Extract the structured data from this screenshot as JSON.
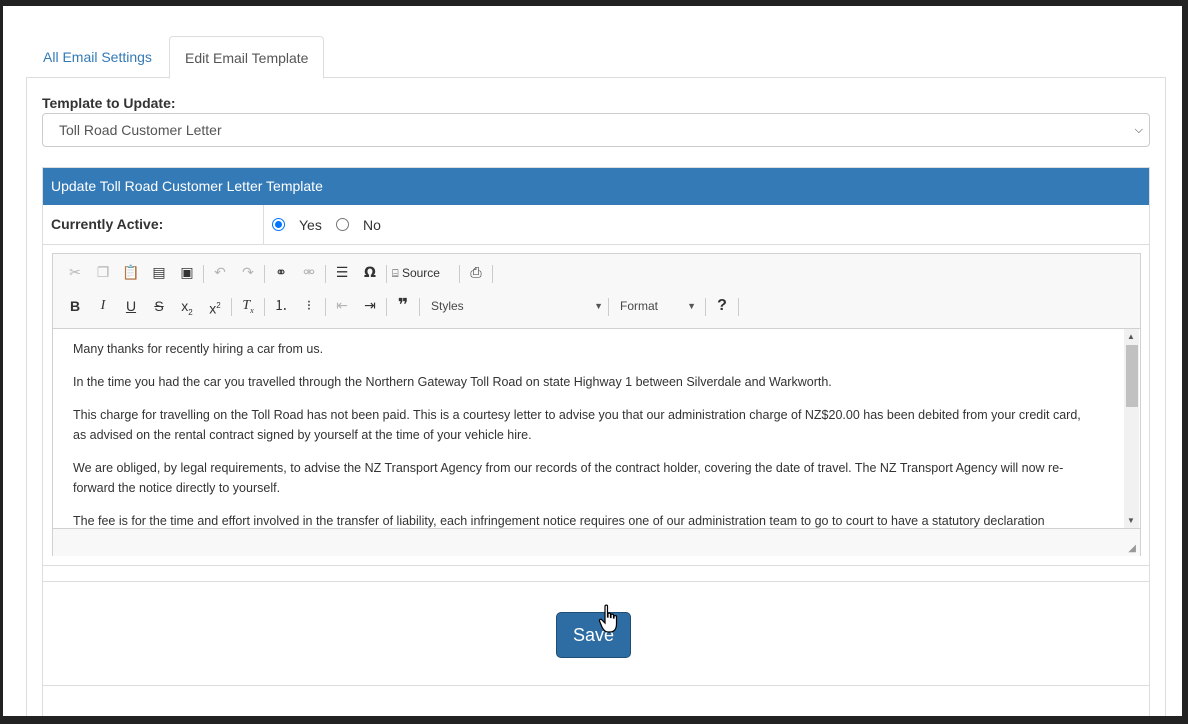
{
  "tabs": [
    {
      "label": "All Email Settings",
      "active": false
    },
    {
      "label": "Edit Email Template",
      "active": true
    }
  ],
  "template_select": {
    "label": "Template to Update:",
    "value": "Toll Road Customer Letter"
  },
  "panel": {
    "heading": "Update Toll Road Customer Letter Template",
    "accent_color": "#337ab7",
    "currently_active": {
      "label": "Currently Active:",
      "options": [
        "Yes",
        "No"
      ],
      "selected": "Yes"
    }
  },
  "editor": {
    "toolbar_row1": {
      "icons": [
        "cut-icon",
        "copy-icon",
        "paste-icon",
        "paste-text-icon",
        "paste-word-icon",
        "undo-icon",
        "redo-icon",
        "link-icon",
        "unlink-icon",
        "horizontal-line-icon",
        "special-char-icon",
        "source-icon",
        "print-icon"
      ],
      "source_label": "Source"
    },
    "toolbar_row2": {
      "icons": [
        "bold-icon",
        "italic-icon",
        "underline-icon",
        "strike-icon",
        "subscript-icon",
        "superscript-icon",
        "remove-format-icon",
        "numbered-list-icon",
        "bulleted-list-icon",
        "outdent-icon",
        "indent-icon",
        "blockquote-icon",
        "help-icon"
      ],
      "styles_label": "Styles",
      "format_label": "Format"
    },
    "paragraphs": [
      "Many thanks for recently hiring a car from us.",
      "In the time you had the car you travelled through the Northern Gateway Toll Road on state Highway 1 between Silverdale and Warkworth.",
      "This charge for travelling on the Toll Road has not been paid. This is a courtesy letter to advise you that our administration charge of NZ$20.00 has been debited from your credit card, as advised on the rental contract signed by yourself at the time of your vehicle hire.",
      "We are obliged, by legal requirements, to advise the NZ Transport Agency from our records of the contract holder, covering the date of travel. The NZ Transport Agency will now re-forward the notice directly to yourself.",
      "The fee is for the time and effort involved in the transfer of liability, each infringement notice requires one of our administration team to go to court to have a statutory declaration"
    ]
  },
  "save_button": {
    "label": "Save",
    "color": "#2e6da4"
  }
}
